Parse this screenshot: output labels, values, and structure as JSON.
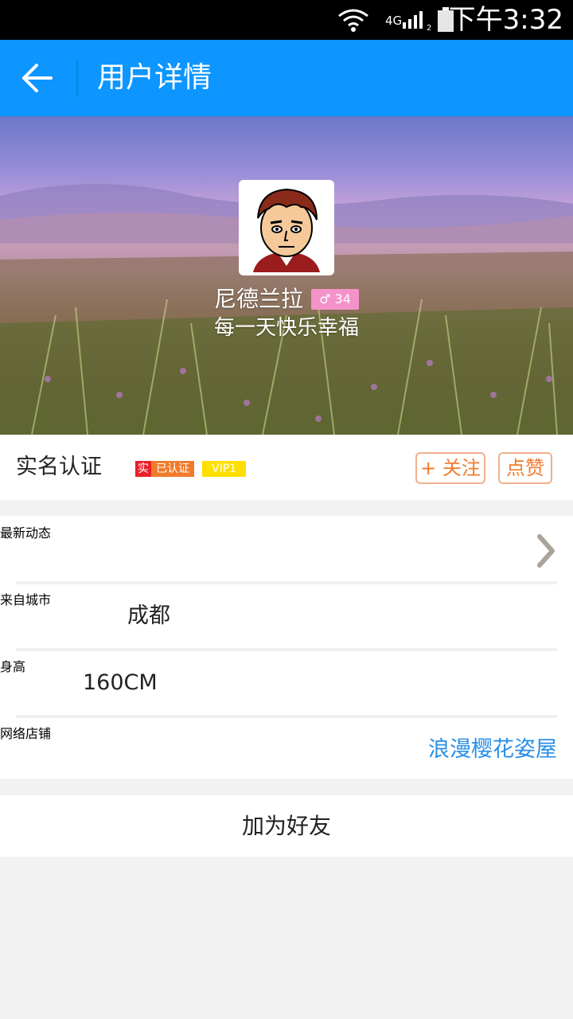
{
  "status_bar": {
    "network": "4G",
    "sim": "2",
    "time": "下午3:32",
    "icons": [
      "wifi-icon",
      "signal-icon",
      "battery-icon"
    ]
  },
  "app_bar": {
    "title": "用户详情",
    "back_icon": "arrow-left-icon"
  },
  "profile": {
    "name": "尼德兰拉",
    "gender_symbol": "♂",
    "age": "34",
    "motto": "每一天快乐幸福"
  },
  "verification": {
    "label": "实名认证",
    "badge_real": "实",
    "badge_verified": "已认证",
    "badge_vip": "VIP1",
    "follow_label": "+ 关注",
    "like_label": "点赞"
  },
  "info": {
    "latest": {
      "label": "最新动态"
    },
    "city": {
      "label": "来自城市",
      "value": "成都"
    },
    "height": {
      "label": "身高",
      "value": "160CM"
    },
    "shop": {
      "label": "网络店铺",
      "value": "浪漫樱花姿屋"
    }
  },
  "actions": {
    "add_friend": "加为好友"
  },
  "colors": {
    "app_bar": "#0d96ff",
    "accent_orange": "#f07b2b",
    "verified_red": "#e8212a",
    "vip_yellow": "#ffdf00",
    "gender_pink": "#f592c9",
    "link_blue": "#2a8fe6"
  }
}
